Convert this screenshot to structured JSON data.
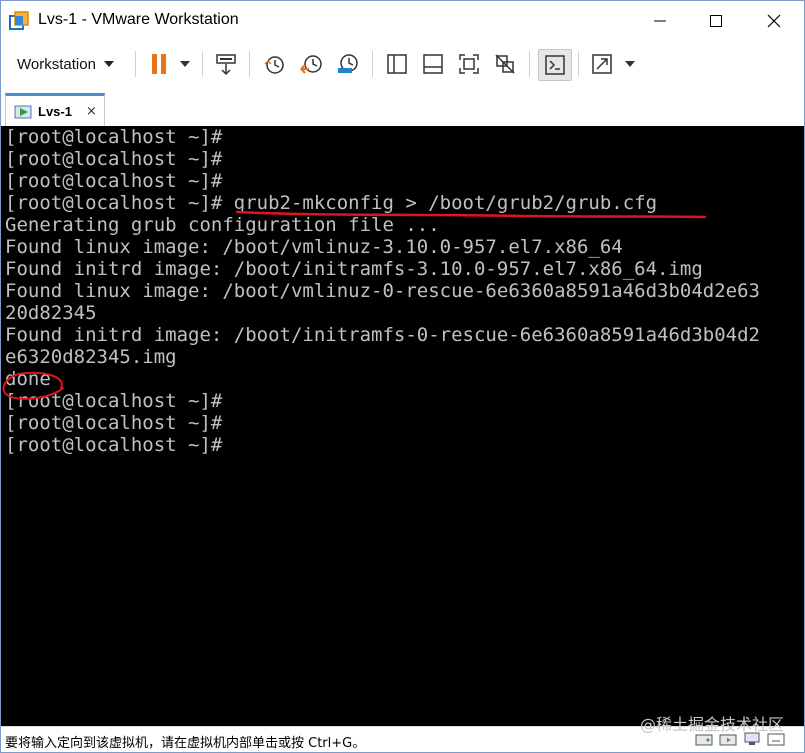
{
  "window": {
    "title": "Lvs-1 - VMware Workstation"
  },
  "toolbar": {
    "menu_label": "Workstation"
  },
  "tabs": [
    {
      "label": "Lvs-1",
      "close_glyph": "×"
    }
  ],
  "terminal": {
    "lines": [
      "[root@localhost ~]#",
      "[root@localhost ~]#",
      "[root@localhost ~]#",
      "[root@localhost ~]# grub2-mkconfig > /boot/grub2/grub.cfg",
      "Generating grub configuration file ...",
      "Found linux image: /boot/vmlinuz-3.10.0-957.el7.x86_64",
      "Found initrd image: /boot/initramfs-3.10.0-957.el7.x86_64.img",
      "Found linux image: /boot/vmlinuz-0-rescue-6e6360a8591a46d3b04d2e63",
      "20d82345",
      "Found initrd image: /boot/initramfs-0-rescue-6e6360a8591a46d3b04d2",
      "e6320d82345.img",
      "done",
      "[root@localhost ~]#",
      "[root@localhost ~]#",
      "[root@localhost ~]#"
    ],
    "text_color": "#c0c0c0",
    "background": "#000000",
    "annotation_color": "#e0141e"
  },
  "status": {
    "message": "要将输入定向到该虚拟机，请在虚拟机内部单击或按 Ctrl+G。",
    "watermark": "@稀土掘金技术社区"
  },
  "icons": {
    "app": "vmware-icon",
    "pause": "pause-icon",
    "snapshot": [
      "snapshot-icon",
      "revert-snapshot-icon",
      "snapshot-manager-icon"
    ],
    "view": [
      "library-icon",
      "thumbnail-bar-icon",
      "full-screen-icon",
      "unity-icon",
      "console-view-icon",
      "stretch-icon"
    ]
  },
  "colors": {
    "tab_accent": "#4b8bd1",
    "pause": "#e8731c",
    "window_border": "#7a9cc6"
  }
}
